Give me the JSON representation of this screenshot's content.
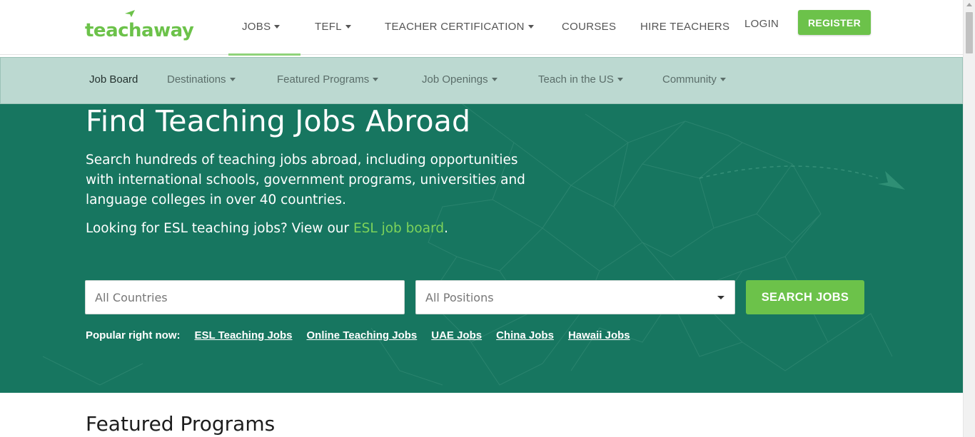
{
  "logo": {
    "text": "teachaway",
    "icon": "paper-plane-icon"
  },
  "topnav": {
    "jobs": "JOBS",
    "tefl": "TEFL",
    "teacher_certification": "TEACHER CERTIFICATION",
    "courses": "COURSES",
    "hire_teachers": "HIRE TEACHERS",
    "login": "LOGIN",
    "register": "REGISTER"
  },
  "subnav": {
    "job_board": "Job Board",
    "destinations": "Destinations",
    "featured_programs": "Featured Programs",
    "job_openings": "Job Openings",
    "teach_in_us": "Teach in the US",
    "community": "Community"
  },
  "hero": {
    "title": "Find Teaching Jobs Abroad",
    "description": "Search hundreds of teaching jobs abroad, including opportunities with international schools, government programs, universities and language colleges in over 40 countries.",
    "esl_prefix": "Looking for ESL teaching jobs? View our ",
    "esl_link": "ESL job board",
    "esl_suffix": "."
  },
  "search": {
    "country_placeholder": "All Countries",
    "position_value": "All Positions",
    "button": "SEARCH JOBS"
  },
  "popular": {
    "label": "Popular right now:",
    "links": [
      "ESL Teaching Jobs",
      "Online Teaching Jobs",
      "UAE Jobs",
      "China Jobs",
      "Hawaii Jobs"
    ]
  },
  "featured": {
    "title": "Featured Programs"
  },
  "colors": {
    "brand_green": "#6cc24a",
    "hero_teal": "#177660",
    "subnav_bg": "#bcd9d1",
    "link_green": "#7dd35a"
  }
}
